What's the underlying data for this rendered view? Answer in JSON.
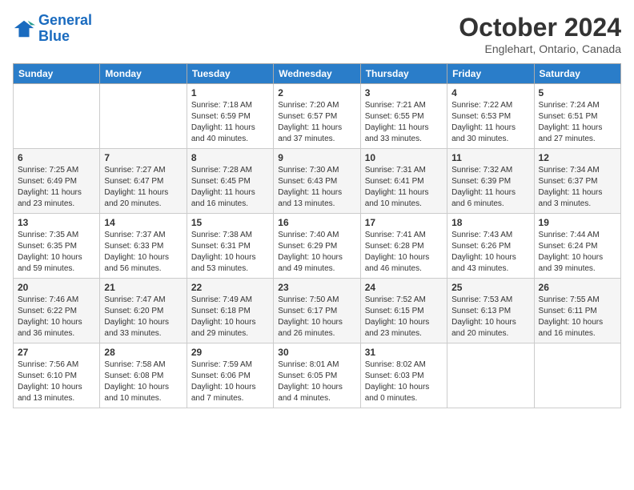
{
  "header": {
    "logo_line1": "General",
    "logo_line2": "Blue",
    "month": "October 2024",
    "location": "Englehart, Ontario, Canada"
  },
  "days_of_week": [
    "Sunday",
    "Monday",
    "Tuesday",
    "Wednesday",
    "Thursday",
    "Friday",
    "Saturday"
  ],
  "weeks": [
    [
      {
        "num": "",
        "info": ""
      },
      {
        "num": "",
        "info": ""
      },
      {
        "num": "1",
        "info": "Sunrise: 7:18 AM\nSunset: 6:59 PM\nDaylight: 11 hours and 40 minutes."
      },
      {
        "num": "2",
        "info": "Sunrise: 7:20 AM\nSunset: 6:57 PM\nDaylight: 11 hours and 37 minutes."
      },
      {
        "num": "3",
        "info": "Sunrise: 7:21 AM\nSunset: 6:55 PM\nDaylight: 11 hours and 33 minutes."
      },
      {
        "num": "4",
        "info": "Sunrise: 7:22 AM\nSunset: 6:53 PM\nDaylight: 11 hours and 30 minutes."
      },
      {
        "num": "5",
        "info": "Sunrise: 7:24 AM\nSunset: 6:51 PM\nDaylight: 11 hours and 27 minutes."
      }
    ],
    [
      {
        "num": "6",
        "info": "Sunrise: 7:25 AM\nSunset: 6:49 PM\nDaylight: 11 hours and 23 minutes."
      },
      {
        "num": "7",
        "info": "Sunrise: 7:27 AM\nSunset: 6:47 PM\nDaylight: 11 hours and 20 minutes."
      },
      {
        "num": "8",
        "info": "Sunrise: 7:28 AM\nSunset: 6:45 PM\nDaylight: 11 hours and 16 minutes."
      },
      {
        "num": "9",
        "info": "Sunrise: 7:30 AM\nSunset: 6:43 PM\nDaylight: 11 hours and 13 minutes."
      },
      {
        "num": "10",
        "info": "Sunrise: 7:31 AM\nSunset: 6:41 PM\nDaylight: 11 hours and 10 minutes."
      },
      {
        "num": "11",
        "info": "Sunrise: 7:32 AM\nSunset: 6:39 PM\nDaylight: 11 hours and 6 minutes."
      },
      {
        "num": "12",
        "info": "Sunrise: 7:34 AM\nSunset: 6:37 PM\nDaylight: 11 hours and 3 minutes."
      }
    ],
    [
      {
        "num": "13",
        "info": "Sunrise: 7:35 AM\nSunset: 6:35 PM\nDaylight: 10 hours and 59 minutes."
      },
      {
        "num": "14",
        "info": "Sunrise: 7:37 AM\nSunset: 6:33 PM\nDaylight: 10 hours and 56 minutes."
      },
      {
        "num": "15",
        "info": "Sunrise: 7:38 AM\nSunset: 6:31 PM\nDaylight: 10 hours and 53 minutes."
      },
      {
        "num": "16",
        "info": "Sunrise: 7:40 AM\nSunset: 6:29 PM\nDaylight: 10 hours and 49 minutes."
      },
      {
        "num": "17",
        "info": "Sunrise: 7:41 AM\nSunset: 6:28 PM\nDaylight: 10 hours and 46 minutes."
      },
      {
        "num": "18",
        "info": "Sunrise: 7:43 AM\nSunset: 6:26 PM\nDaylight: 10 hours and 43 minutes."
      },
      {
        "num": "19",
        "info": "Sunrise: 7:44 AM\nSunset: 6:24 PM\nDaylight: 10 hours and 39 minutes."
      }
    ],
    [
      {
        "num": "20",
        "info": "Sunrise: 7:46 AM\nSunset: 6:22 PM\nDaylight: 10 hours and 36 minutes."
      },
      {
        "num": "21",
        "info": "Sunrise: 7:47 AM\nSunset: 6:20 PM\nDaylight: 10 hours and 33 minutes."
      },
      {
        "num": "22",
        "info": "Sunrise: 7:49 AM\nSunset: 6:18 PM\nDaylight: 10 hours and 29 minutes."
      },
      {
        "num": "23",
        "info": "Sunrise: 7:50 AM\nSunset: 6:17 PM\nDaylight: 10 hours and 26 minutes."
      },
      {
        "num": "24",
        "info": "Sunrise: 7:52 AM\nSunset: 6:15 PM\nDaylight: 10 hours and 23 minutes."
      },
      {
        "num": "25",
        "info": "Sunrise: 7:53 AM\nSunset: 6:13 PM\nDaylight: 10 hours and 20 minutes."
      },
      {
        "num": "26",
        "info": "Sunrise: 7:55 AM\nSunset: 6:11 PM\nDaylight: 10 hours and 16 minutes."
      }
    ],
    [
      {
        "num": "27",
        "info": "Sunrise: 7:56 AM\nSunset: 6:10 PM\nDaylight: 10 hours and 13 minutes."
      },
      {
        "num": "28",
        "info": "Sunrise: 7:58 AM\nSunset: 6:08 PM\nDaylight: 10 hours and 10 minutes."
      },
      {
        "num": "29",
        "info": "Sunrise: 7:59 AM\nSunset: 6:06 PM\nDaylight: 10 hours and 7 minutes."
      },
      {
        "num": "30",
        "info": "Sunrise: 8:01 AM\nSunset: 6:05 PM\nDaylight: 10 hours and 4 minutes."
      },
      {
        "num": "31",
        "info": "Sunrise: 8:02 AM\nSunset: 6:03 PM\nDaylight: 10 hours and 0 minutes."
      },
      {
        "num": "",
        "info": ""
      },
      {
        "num": "",
        "info": ""
      }
    ]
  ]
}
